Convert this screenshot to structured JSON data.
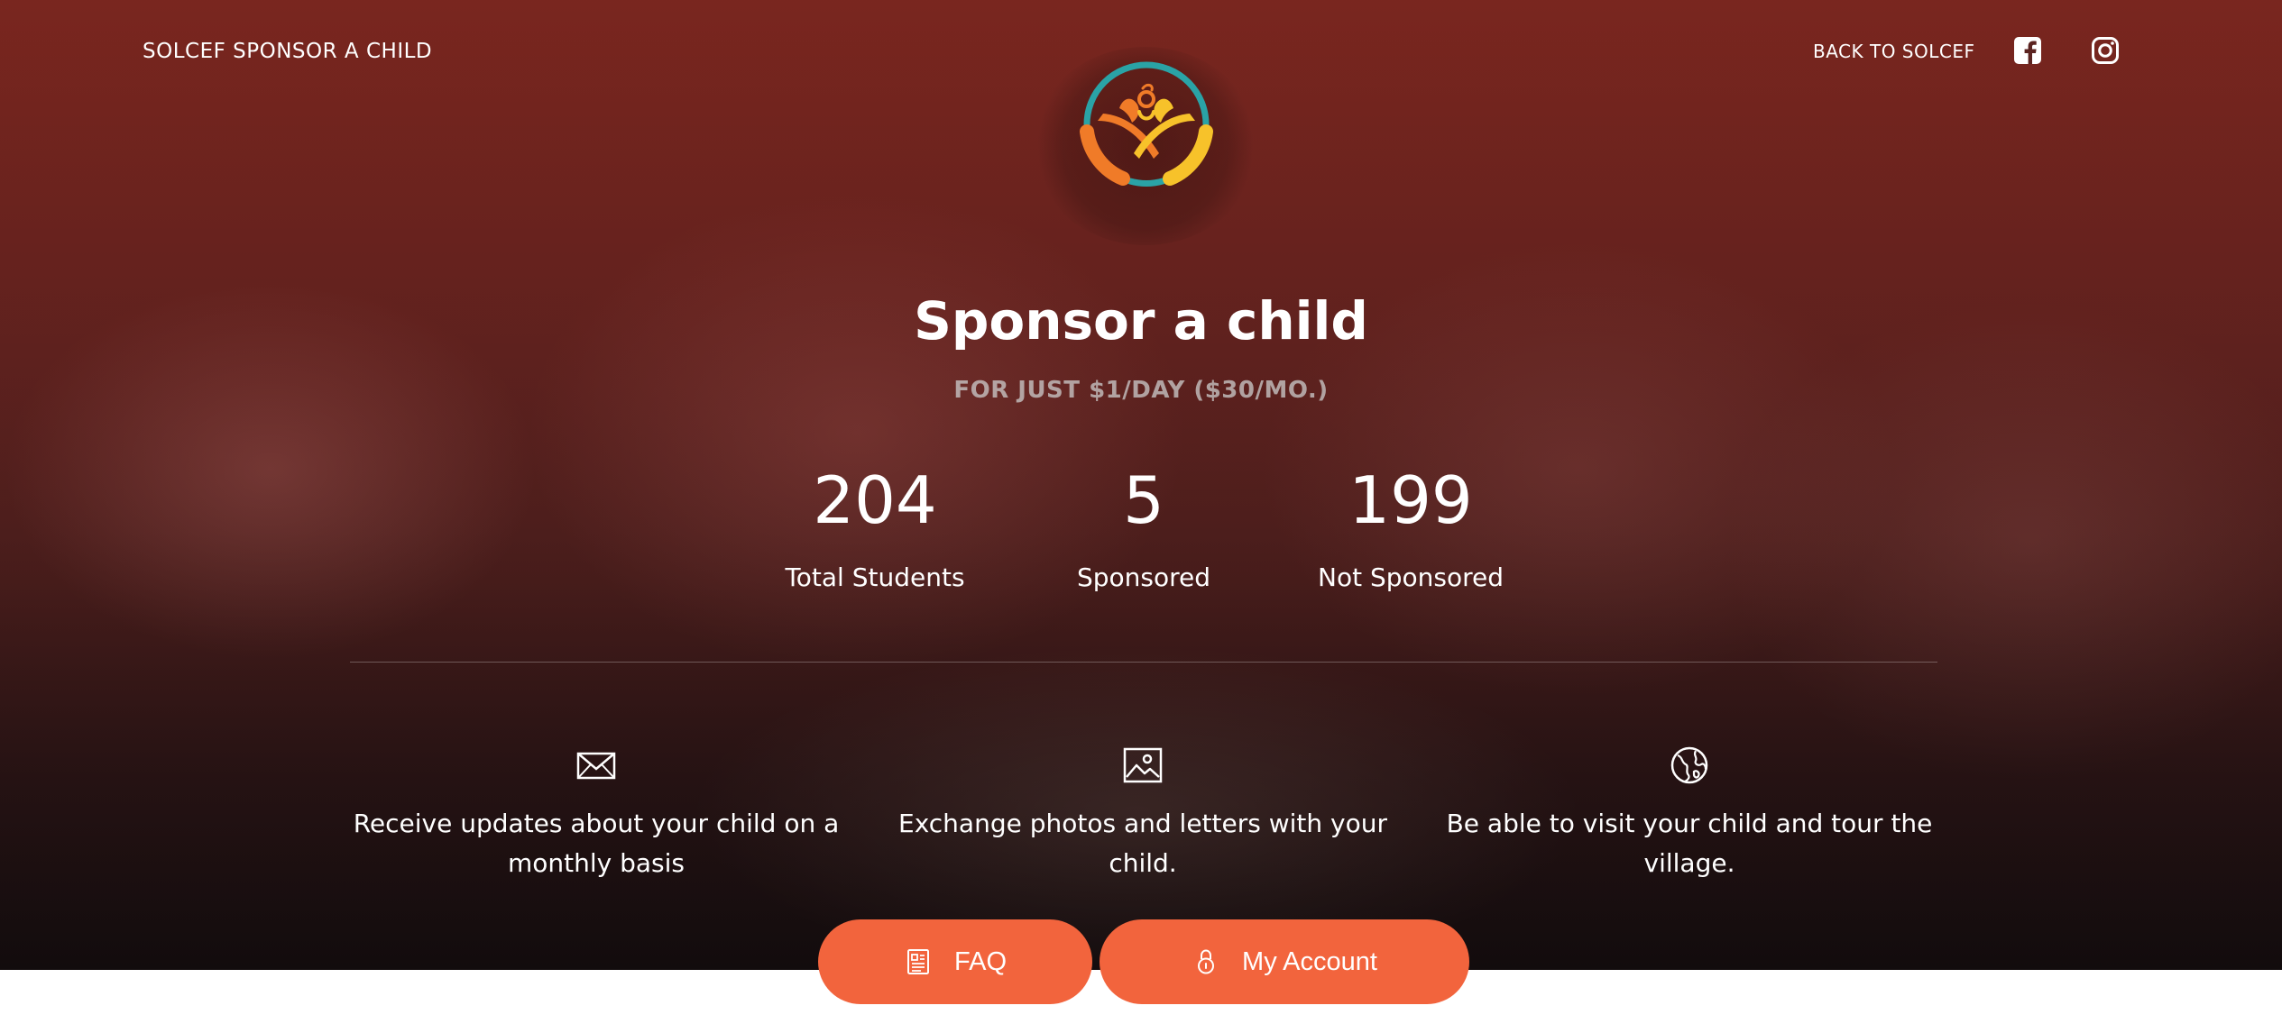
{
  "header": {
    "brand": "SOLCEF SPONSOR A CHILD",
    "back_link": "BACK TO SOLCEF",
    "social": [
      {
        "name": "facebook",
        "icon": "facebook-icon"
      },
      {
        "name": "instagram",
        "icon": "instagram-icon"
      }
    ],
    "logo_icon": "solcef-logo"
  },
  "hero": {
    "title": "Sponsor a child",
    "subtitle": "FOR JUST $1/DAY ($30/MO.)"
  },
  "stats": [
    {
      "value": "204",
      "label": "Total Students"
    },
    {
      "value": "5",
      "label": "Sponsored"
    },
    {
      "value": "199",
      "label": "Not Sponsored"
    }
  ],
  "features": [
    {
      "icon": "envelope-icon",
      "text": "Receive updates about your child on a monthly basis"
    },
    {
      "icon": "image-icon",
      "text": "Exchange photos and letters with your child."
    },
    {
      "icon": "globe-icon",
      "text": "Be able to visit your child and tour the village."
    }
  ],
  "buttons": {
    "faq": {
      "label": "FAQ",
      "icon": "document-icon"
    },
    "account": {
      "label": "My Account",
      "icon": "lock-icon"
    }
  },
  "colors": {
    "accent": "#f2643d",
    "logo_teal": "#2aa3a6",
    "logo_orange": "#f07b28",
    "logo_yellow": "#f7c22a"
  }
}
